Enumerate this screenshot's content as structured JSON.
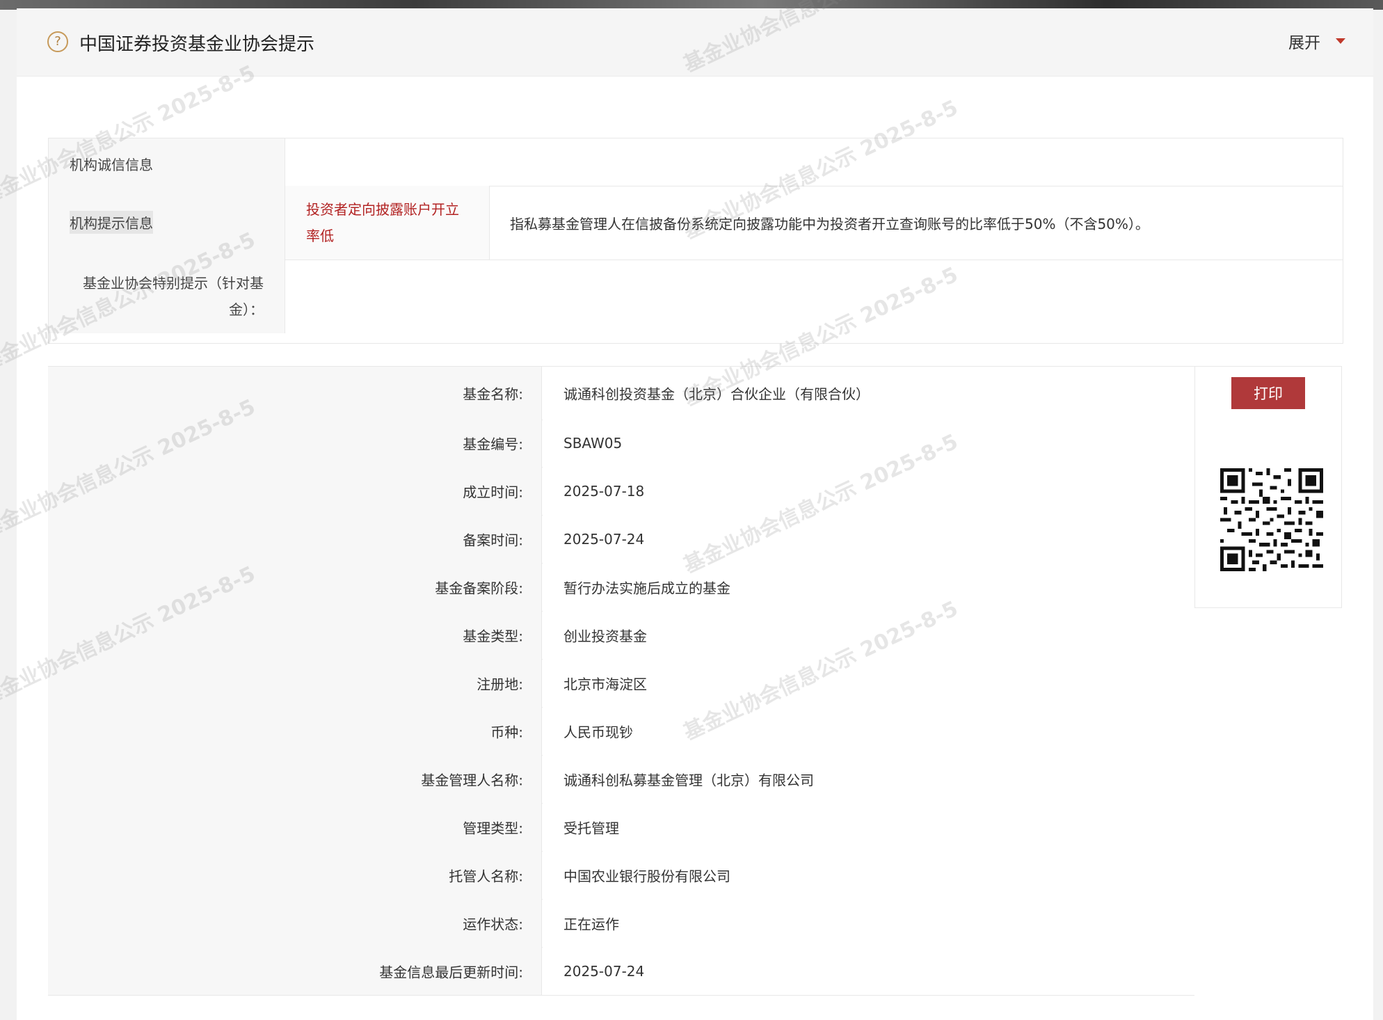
{
  "notice": {
    "title": "中国证券投资基金业协会提示",
    "expand_label": "展开",
    "help_glyph": "?"
  },
  "info_table": {
    "credit_label": "机构诚信信息",
    "credit_value": "",
    "hint_label": "机构提示信息",
    "hint_tag": "投资者定向披露账户开立率低",
    "hint_tag_line1": "投资者定向披露账户开立",
    "hint_tag_line2": "率低",
    "hint_desc": "指私募基金管理人在信披备份系统定向披露功能中为投资者开立查询账号的比率低于50%（不含50%）。",
    "special_label_line1": "基金业协会特别提示（针对基",
    "special_label_line2": "金）：",
    "special_value": ""
  },
  "fund": {
    "print_label": "打印",
    "rows": [
      {
        "label": "基金名称:",
        "value": "诚通科创投资基金（北京）合伙企业（有限合伙）"
      },
      {
        "label": "基金编号:",
        "value": "SBAW05"
      },
      {
        "label": "成立时间:",
        "value": "2025-07-18"
      },
      {
        "label": "备案时间:",
        "value": "2025-07-24"
      },
      {
        "label": "基金备案阶段:",
        "value": "暂行办法实施后成立的基金"
      },
      {
        "label": "基金类型:",
        "value": "创业投资基金"
      },
      {
        "label": "注册地:",
        "value": "北京市海淀区"
      },
      {
        "label": "币种:",
        "value": "人民币现钞"
      },
      {
        "label": "基金管理人名称:",
        "value": "诚通科创私募基金管理（北京）有限公司"
      },
      {
        "label": "管理类型:",
        "value": "受托管理"
      },
      {
        "label": "托管人名称:",
        "value": "中国农业银行股份有限公司"
      },
      {
        "label": "运作状态:",
        "value": "正在运作"
      },
      {
        "label": "基金信息最后更新时间:",
        "value": "2025-07-24"
      }
    ]
  },
  "watermark_text": "基金业协会信息公示 2025-8-5",
  "colors": {
    "accent_red": "#b0393a",
    "tag_red": "#b22222",
    "label_bg": "#f7f7f7",
    "border": "#e8e8e8"
  }
}
